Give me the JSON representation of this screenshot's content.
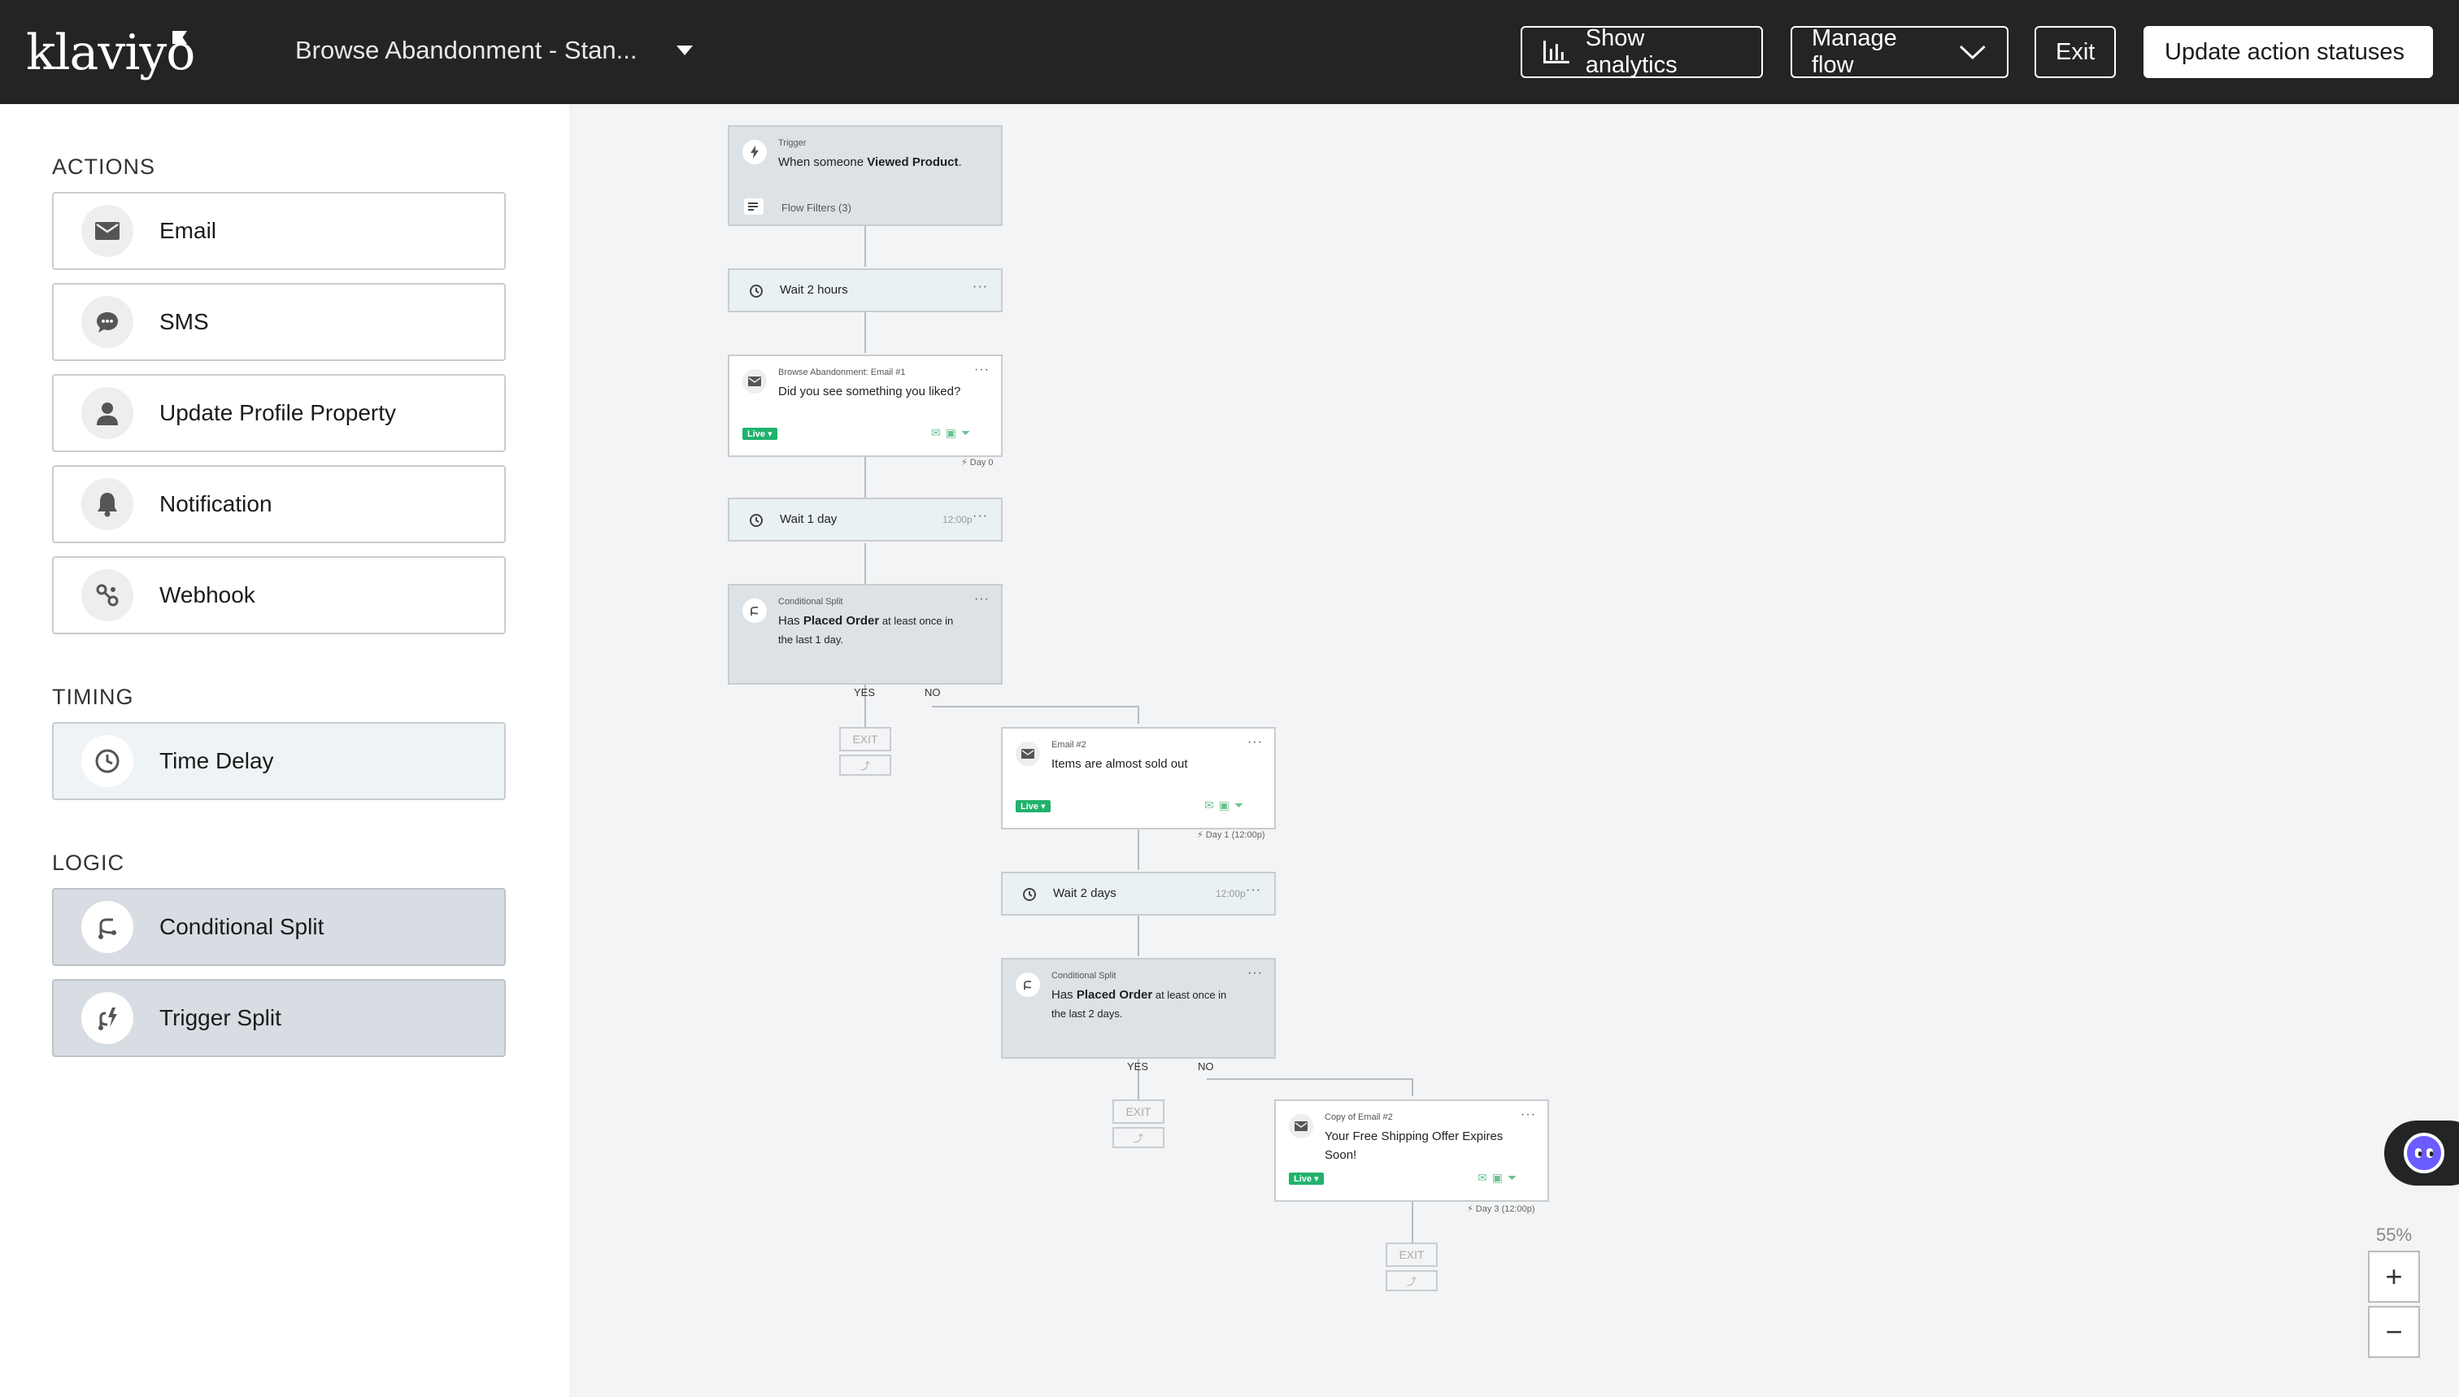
{
  "topbar": {
    "logo": "klaviyo",
    "flow_title": "Browse Abandonment - Stan...",
    "show_analytics": "Show analytics",
    "manage_flow": "Manage flow",
    "exit": "Exit",
    "update_statuses": "Update action statuses"
  },
  "sidebar": {
    "actions_title": "ACTIONS",
    "actions": [
      {
        "label": "Email",
        "icon": "envelope-icon"
      },
      {
        "label": "SMS",
        "icon": "chat-bubble-icon"
      },
      {
        "label": "Update Profile Property",
        "icon": "person-icon"
      },
      {
        "label": "Notification",
        "icon": "bell-icon"
      },
      {
        "label": "Webhook",
        "icon": "webhook-icon"
      }
    ],
    "timing_title": "TIMING",
    "timing": [
      {
        "label": "Time Delay",
        "icon": "clock-icon"
      }
    ],
    "logic_title": "LOGIC",
    "logic": [
      {
        "label": "Conditional Split",
        "icon": "split-icon"
      },
      {
        "label": "Trigger Split",
        "icon": "trigger-split-icon"
      }
    ]
  },
  "canvas": {
    "trigger": {
      "small": "Trigger",
      "text_pre": "When someone ",
      "text_bold": "Viewed Product",
      "text_post": ".",
      "filters": "Flow Filters (3)"
    },
    "wait1": {
      "label": "Wait 2 hours"
    },
    "email1": {
      "small": "Browse Abandonment: Email #1",
      "subject": "Did you see something you liked?",
      "status": "Live",
      "day": "Day 0"
    },
    "wait2": {
      "label": "Wait 1 day",
      "time": "12:00p"
    },
    "split1": {
      "small": "Conditional Split",
      "pre": "Has ",
      "bold": "Placed Order",
      "post": " at least once in",
      "line2": "the last 1 day.",
      "yes": "YES",
      "no": "NO",
      "exit": "EXIT"
    },
    "email2": {
      "small": "Email #2",
      "subject": "Items are almost sold out",
      "status": "Live",
      "day": "Day 1 (12:00p)"
    },
    "wait3": {
      "label": "Wait 2 days",
      "time": "12:00p"
    },
    "split2": {
      "small": "Conditional Split",
      "pre": "Has ",
      "bold": "Placed Order",
      "post": " at least once in",
      "line2": "the last 2 days.",
      "yes": "YES",
      "no": "NO",
      "exit": "EXIT"
    },
    "email3": {
      "small": "Copy of Email #2",
      "subject": "Your Free Shipping Offer Expires",
      "subject2": "Soon!",
      "status": "Live",
      "day": "Day 3 (12:00p)"
    },
    "exit_final": "EXIT"
  },
  "zoom": {
    "level": "55%",
    "plus": "+",
    "minus": "−"
  },
  "dots": "···",
  "colors": {
    "topbar": "#232426",
    "live": "#20b26c",
    "canvas": "#f3f4f5"
  }
}
